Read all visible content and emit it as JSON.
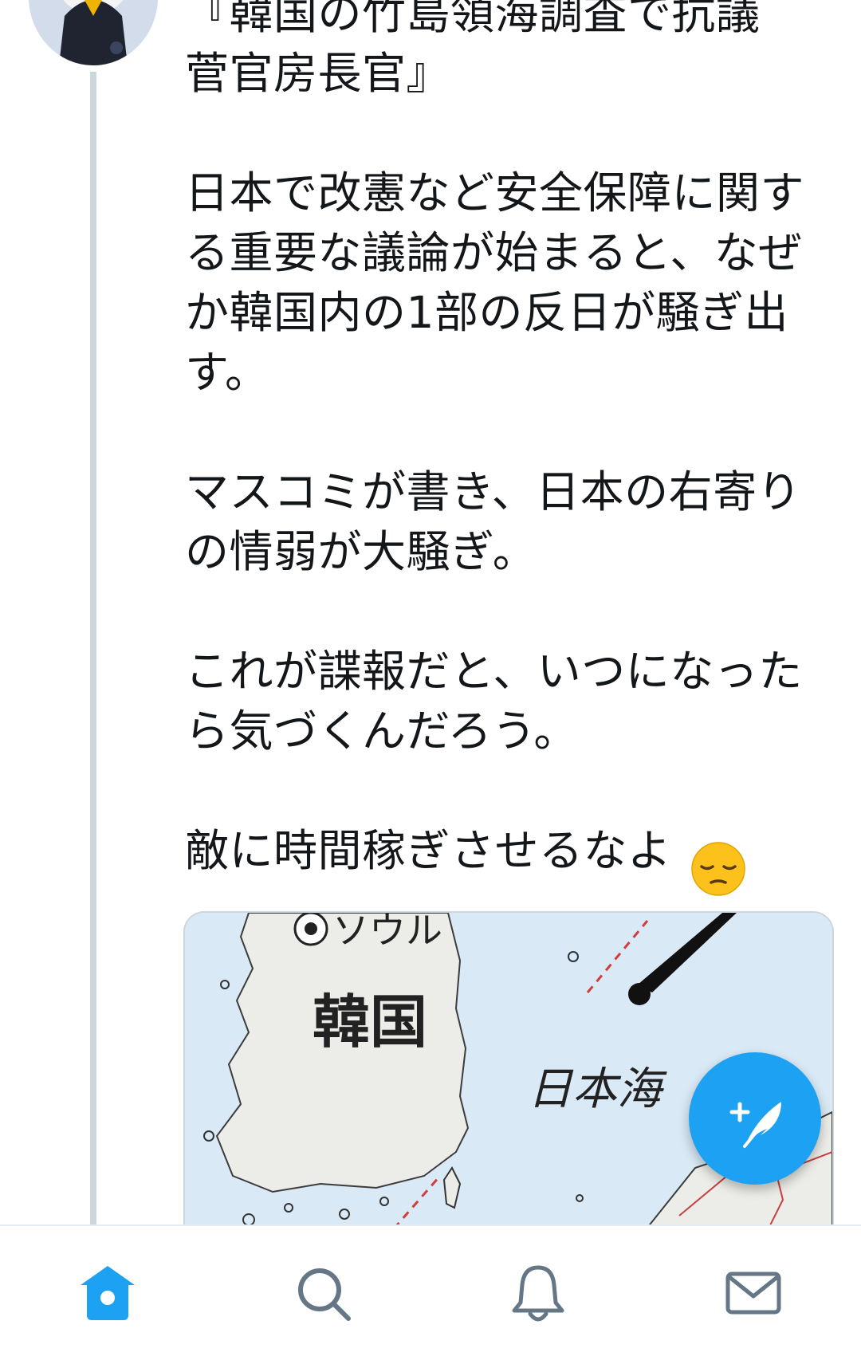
{
  "tweet": {
    "text": "『韓国の竹島領海調査で抗議\n菅官房長官』\n\n日本で改憲など安全保障に関す\nる重要な議論が始まると、なぜ\nか韓国内の1部の反日が騒ぎ出\nす。\n\nマスコミが書き、日本の右寄り\nの情弱が大騒ぎ。\n\nこれが諜報だと、いつになった\nら気づくんだろう。\n\n敵に時間稼ぎさせるなよ",
    "emoji": "pensive-face"
  },
  "media": {
    "map_labels": {
      "seoul": "ソウル",
      "korea": "韓国",
      "sea_of_japan": "日本海"
    }
  },
  "tabs": [
    {
      "id": "home",
      "icon": "home-icon",
      "active": true
    },
    {
      "id": "search",
      "icon": "search-icon",
      "active": false
    },
    {
      "id": "notifications",
      "icon": "bell-icon",
      "active": false
    },
    {
      "id": "messages",
      "icon": "mail-icon",
      "active": false
    }
  ],
  "colors": {
    "accent": "#1da1f2",
    "text": "#14171a",
    "inactive_icon": "#657786",
    "thread_line": "#ccd6dd",
    "sea": "#d9e9f5",
    "land": "#ecece8"
  }
}
